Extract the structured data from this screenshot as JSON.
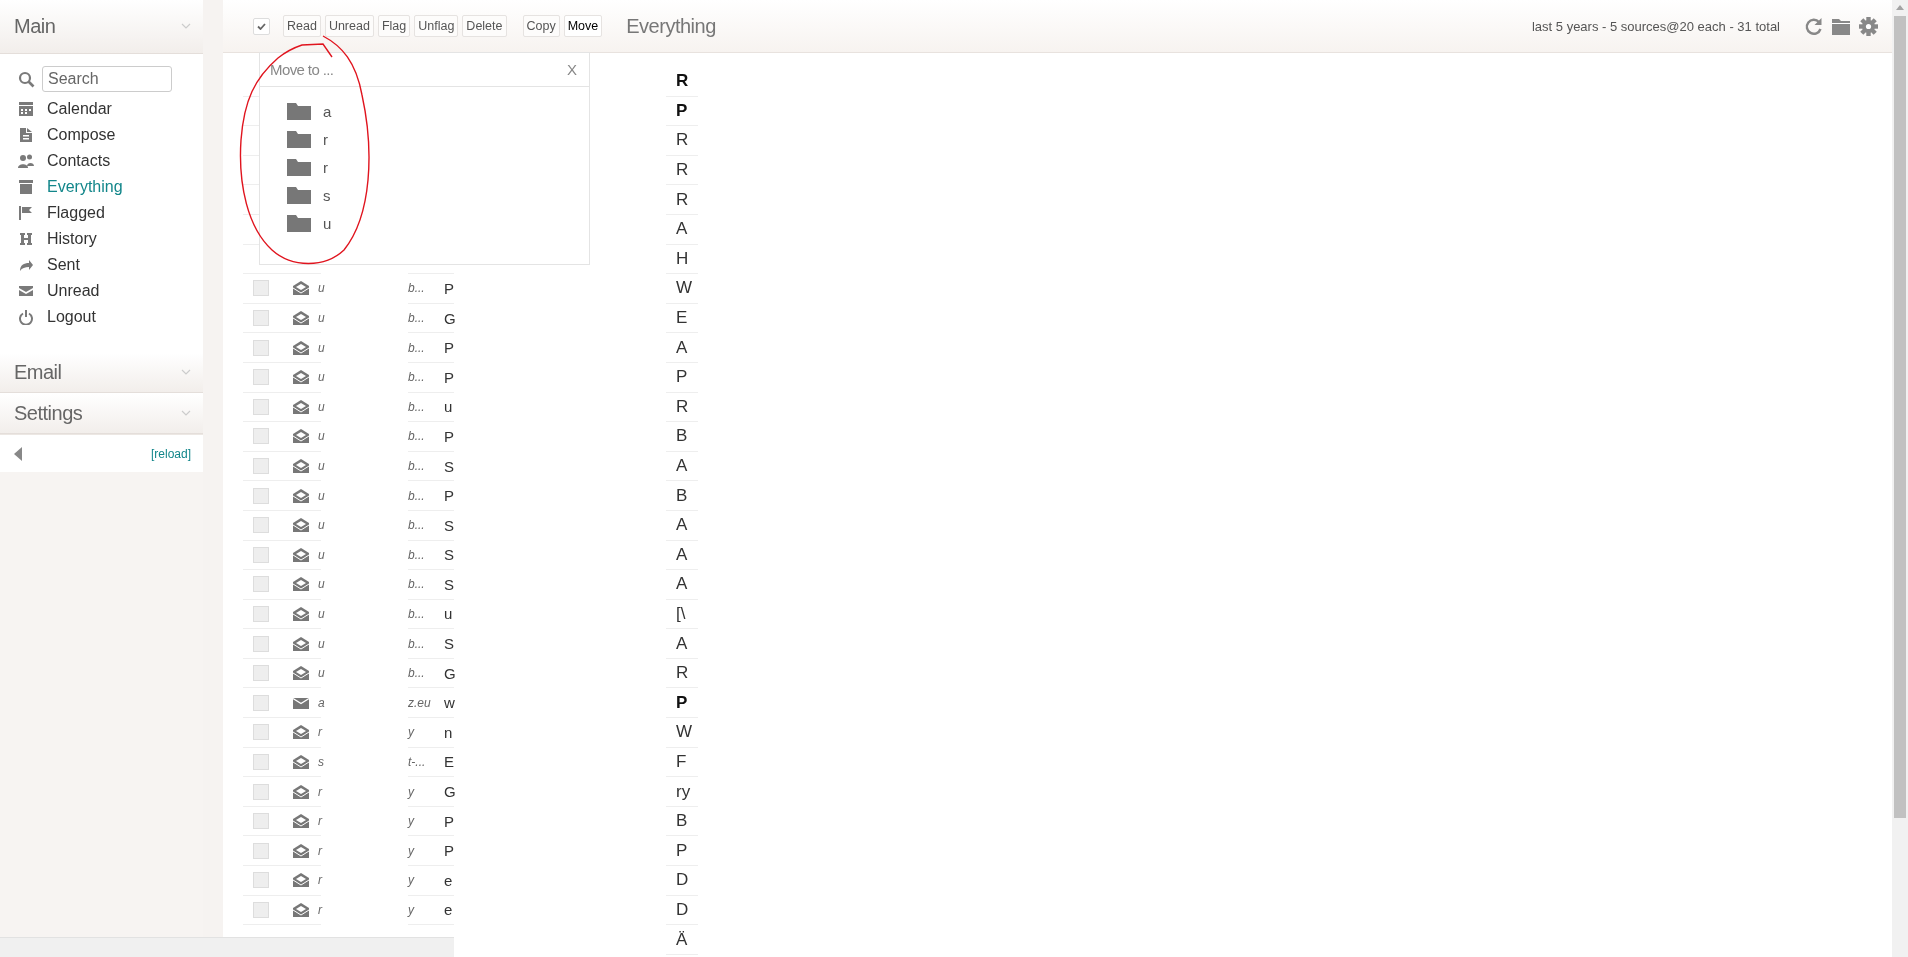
{
  "sidebar": {
    "title": "Main",
    "search": {
      "placeholder": "Search"
    },
    "items": [
      {
        "label": "Calendar",
        "selected": false
      },
      {
        "label": "Compose",
        "selected": false
      },
      {
        "label": "Contacts",
        "selected": false
      },
      {
        "label": "Everything",
        "selected": true
      },
      {
        "label": "Flagged",
        "selected": false
      },
      {
        "label": "History",
        "selected": false
      },
      {
        "label": "Sent",
        "selected": false
      },
      {
        "label": "Unread",
        "selected": false
      },
      {
        "label": "Logout",
        "selected": false
      }
    ],
    "sections": [
      "Email",
      "Settings"
    ],
    "reload": "[reload]"
  },
  "toolbar": {
    "buttons": [
      {
        "label": "Read",
        "selected": false
      },
      {
        "label": "Unread",
        "selected": false
      },
      {
        "label": "Flag",
        "selected": false
      },
      {
        "label": "Unflag",
        "selected": false
      },
      {
        "label": "Delete",
        "selected": false
      }
    ],
    "folder_buttons": [
      {
        "label": "Copy",
        "selected": false
      },
      {
        "label": "Move",
        "selected": true
      }
    ],
    "title": "Everything",
    "summary": "last 5 years - 5 sources@20 each - 31 total"
  },
  "move_popup": {
    "title": "Move to ...",
    "close": "X",
    "folders": [
      "a",
      "r",
      "r",
      "s",
      "u"
    ]
  },
  "messages": [
    {
      "unread": true,
      "column_4": "R"
    },
    {
      "unread": true,
      "column_4": "P"
    },
    {
      "unread": false,
      "column_4": "R"
    },
    {
      "unread": false,
      "column_4": "R"
    },
    {
      "unread": false,
      "column_4": "R"
    },
    {
      "unread": false,
      "column_4": "A"
    },
    {
      "unread": false,
      "column_4": "H"
    },
    {
      "unread": false,
      "checked": false,
      "from": "u",
      "from_tail": "b...",
      "subject": "P",
      "column_4": "W"
    },
    {
      "unread": false,
      "checked": false,
      "from": "u",
      "from_tail": "b...",
      "subject": "G",
      "column_4": "E"
    },
    {
      "unread": false,
      "checked": false,
      "from": "u",
      "from_tail": "b...",
      "subject": "P",
      "column_4": "A"
    },
    {
      "unread": false,
      "checked": false,
      "from": "u",
      "from_tail": "b...",
      "subject": "P",
      "column_4": "P"
    },
    {
      "unread": false,
      "checked": false,
      "from": "u",
      "from_tail": "b...",
      "subject": "u",
      "column_4": "R"
    },
    {
      "unread": false,
      "checked": false,
      "from": "u",
      "from_tail": "b...",
      "subject": "P",
      "column_4": "B"
    },
    {
      "unread": false,
      "checked": false,
      "from": "u",
      "from_tail": "b...",
      "subject": "S",
      "column_4": "A"
    },
    {
      "unread": false,
      "checked": false,
      "from": "u",
      "from_tail": "b...",
      "subject": "P",
      "column_4": "B"
    },
    {
      "unread": false,
      "checked": false,
      "from": "u",
      "from_tail": "b...",
      "subject": "S",
      "column_4": "A"
    },
    {
      "unread": false,
      "checked": false,
      "from": "u",
      "from_tail": "b...",
      "subject": "S",
      "column_4": "A"
    },
    {
      "unread": false,
      "checked": false,
      "from": "u",
      "from_tail": "b...",
      "subject": "S",
      "column_4": "A"
    },
    {
      "unread": false,
      "checked": false,
      "from": "u",
      "from_tail": "b...",
      "subject": "u",
      "column_4": "[\\"
    },
    {
      "unread": false,
      "checked": false,
      "from": "u",
      "from_tail": "b...",
      "subject": "S",
      "column_4": "A"
    },
    {
      "unread": false,
      "checked": false,
      "from": "u",
      "from_tail": "b...",
      "subject": "G",
      "column_4": "R"
    },
    {
      "unread": true,
      "checked": false,
      "from": "a",
      "from_tail": "z.eu",
      "subject": "w",
      "column_4": "P"
    },
    {
      "unread": false,
      "checked": false,
      "from": "r",
      "from_tail": "y",
      "subject": "n",
      "column_4": "W"
    },
    {
      "unread": false,
      "checked": false,
      "from": "s",
      "from_tail": "t-...",
      "subject": "E",
      "column_4": "F"
    },
    {
      "unread": false,
      "checked": false,
      "from": "r",
      "from_tail": "y",
      "subject": "G",
      "column_4": "ry"
    },
    {
      "unread": false,
      "checked": false,
      "from": "r",
      "from_tail": "y",
      "subject": "P",
      "column_4": "B"
    },
    {
      "unread": false,
      "checked": false,
      "from": "r",
      "from_tail": "y",
      "subject": "P",
      "column_4": "P"
    },
    {
      "unread": false,
      "checked": false,
      "from": "r",
      "from_tail": "y",
      "subject": "e",
      "column_4": "D"
    },
    {
      "unread": false,
      "checked": false,
      "from": "r",
      "from_tail": "y",
      "subject": "e",
      "column_4": "D"
    },
    {
      "unread": false,
      "column_4": "Ä"
    }
  ]
}
